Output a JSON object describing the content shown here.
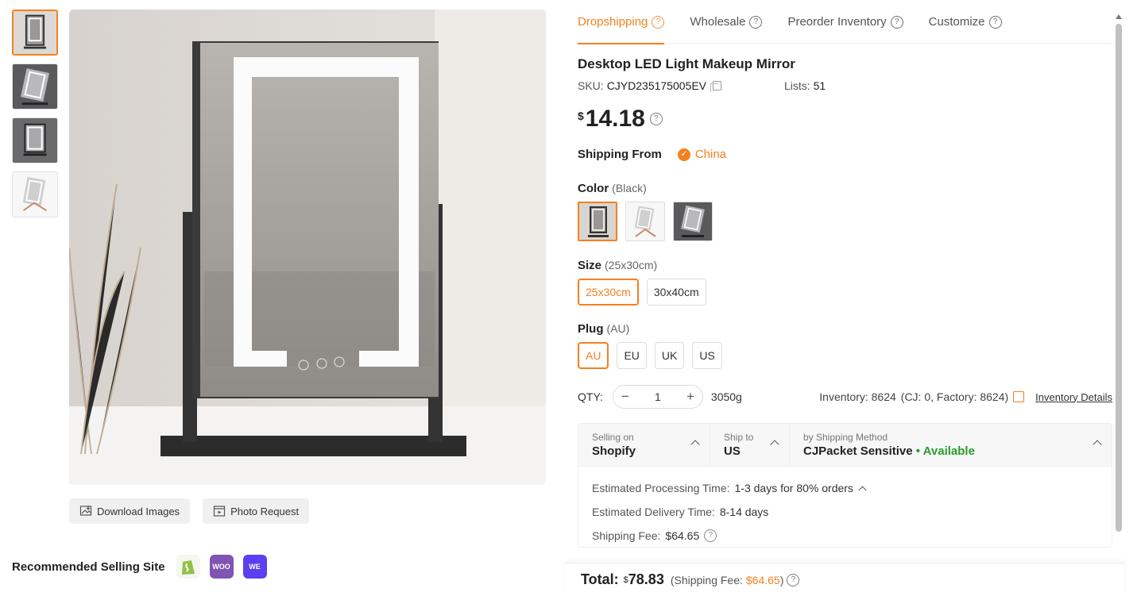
{
  "tabs": [
    {
      "label": "Dropshipping",
      "active": true
    },
    {
      "label": "Wholesale",
      "active": false
    },
    {
      "label": "Preorder Inventory",
      "active": false
    },
    {
      "label": "Customize",
      "active": false
    }
  ],
  "product": {
    "title": "Desktop LED Light Makeup Mirror",
    "sku_label": "SKU:",
    "sku": "CJYD235175005EV",
    "lists_label": "Lists:",
    "lists": "51",
    "price_currency": "$",
    "price": "14.18"
  },
  "shipping_from": {
    "label": "Shipping From",
    "value": "China"
  },
  "color": {
    "label": "Color",
    "selected": "(Black)"
  },
  "size": {
    "label": "Size",
    "selected": "(25x30cm)",
    "options": [
      "25x30cm",
      "30x40cm"
    ]
  },
  "plug": {
    "label": "Plug",
    "selected": "(AU)",
    "options": [
      "AU",
      "EU",
      "UK",
      "US"
    ]
  },
  "qty": {
    "label": "QTY:",
    "value": "1",
    "minus": "−",
    "plus": "+",
    "weight": "3050g",
    "inventory": "Inventory: 8624",
    "inventory_breakdown": "(CJ: 0, Factory: 8624)",
    "inventory_link": "Inventory Details"
  },
  "shipping": {
    "selling_on_label": "Selling on",
    "selling_on": "Shopify",
    "ship_to_label": "Ship to",
    "ship_to": "US",
    "method_label": "by Shipping Method",
    "method": "CJPacket Sensitive",
    "availability": "• Available",
    "processing_label": "Estimated Processing Time:",
    "processing": "1-3 days for 80% orders",
    "delivery_label": "Estimated Delivery Time:",
    "delivery": "8-14 days",
    "fee_label": "Shipping Fee:",
    "fee": "$64.65"
  },
  "total": {
    "label": "Total:",
    "currency": "$",
    "amount": "78.83",
    "fee_prefix": "(Shipping Fee:",
    "fee": "$64.65",
    "fee_suffix": ")"
  },
  "media_actions": {
    "download": "Download Images",
    "photo_request": "Photo Request"
  },
  "recommended": {
    "label": "Recommended Selling Site",
    "sites": [
      "shopify",
      "WOO",
      "WE"
    ]
  },
  "colors": {
    "accent": "#f5801f",
    "available": "#2a9d2a"
  }
}
